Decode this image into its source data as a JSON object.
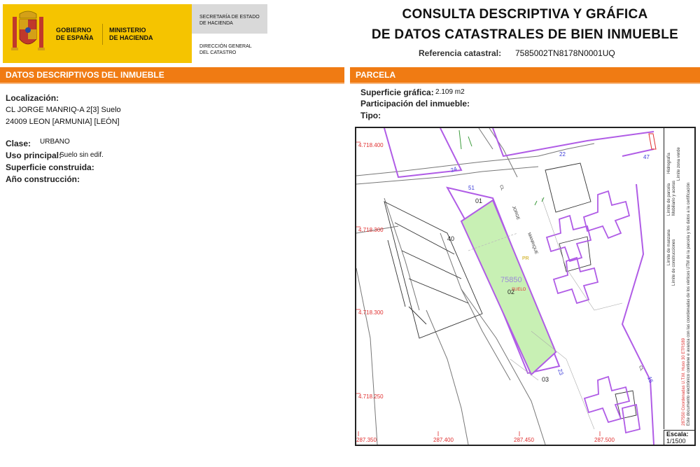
{
  "header": {
    "gobierno": [
      "GOBIERNO",
      "DE ESPAÑA"
    ],
    "ministerio": [
      "MINISTERIO",
      "DE HACIENDA"
    ],
    "secretaria": [
      "SECRETARÍA DE ESTADO",
      "DE HACIENDA"
    ],
    "direccion": [
      "DIRECCIÓN GENERAL",
      "DEL CATASTRO"
    ],
    "title_line1": "CONSULTA DESCRIPTIVA Y GRÁFICA",
    "title_line2": "DE DATOS CATASTRALES DE BIEN INMUEBLE",
    "ref_label": "Referencia catastral:",
    "ref_value": "7585002TN8178N0001UQ"
  },
  "left": {
    "bar": "DATOS DESCRIPTIVOS DEL INMUEBLE",
    "localizacion_label": "Localización:",
    "localizacion_line1": "CL JORGE MANRIQ-A 2[3] Suelo",
    "localizacion_line2": "24009 LEON [ARMUNIA] [LEÓN]",
    "clase_label": "Clase:",
    "clase_value": "URBANO",
    "uso_label": "Uso principal:",
    "uso_value": "Suelo sin edif.",
    "superficie_label": "Superficie construida:",
    "anio_label": "Año construcción:"
  },
  "right": {
    "bar": "PARCELA",
    "sup_grafica_label": "Superficie gráfica:",
    "sup_grafica_value": "2.109 m2",
    "participacion_label": "Participación del inmueble:",
    "tipo_label": "Tipo:"
  },
  "map": {
    "y_ticks": [
      "4.718.400",
      "4.718.300",
      "4.718.300",
      "4.718.250"
    ],
    "x_ticks": [
      "287.350",
      "287.400",
      "287.450",
      "287.500"
    ],
    "labels": {
      "p01": "01",
      "p02": "02",
      "p03": "03",
      "p40": "40",
      "n24": "24",
      "n22": "22",
      "n47": "47",
      "n51": "51",
      "n23": "23",
      "n15": "15",
      "parcel_id": "75850",
      "suelo": "SUELO",
      "pr": "PR",
      "cl": "CL",
      "jorge": "JORGE",
      "manrique": "MANRIQUE",
      "cl2": "CL"
    },
    "legend": {
      "line1": "Límite de manzana",
      "line2": "Límite de parcela",
      "line3": "Límite de construcciones",
      "line4": "Mobiliario y aceras",
      "line5": "Límite zona verde",
      "line6": "Hidrografía",
      "note1": "287550 Coordenadas U.T.M. Huso 30 ETRS89",
      "note2": "Este documento electrónico contiene e avanza con las coordenadas de los vértices UTM de la parcela y los datos a la certificación"
    },
    "escala_label": "Escala:",
    "escala_value": "1/1500"
  },
  "colors": {
    "brand_yellow": "#f5c400",
    "section_orange": "#f07b13",
    "parcel_fill": "#c8f0b4",
    "boundary_purple": "#b05ce6",
    "coord_red": "#e03030"
  }
}
